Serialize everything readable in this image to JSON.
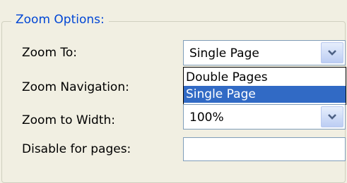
{
  "group": {
    "title": "Zoom Options:"
  },
  "rows": {
    "zoom_to": {
      "label": "Zoom To:",
      "value": "Single Page"
    },
    "zoom_navigation": {
      "label": "Zoom Navigation:"
    },
    "zoom_to_width": {
      "label": "Zoom to Width:",
      "value": "100%"
    },
    "disable_for_pages": {
      "label": "Disable for pages:",
      "value": ""
    }
  },
  "dropdown": {
    "options": [
      "Double Pages",
      "Single Page"
    ],
    "selected_index": 1
  },
  "colors": {
    "legend": "#0046d5",
    "selection": "#316ac5",
    "background": "#f1efe2",
    "field_border": "#7f9db9"
  },
  "icons": {
    "dropdown_arrow": "chevron-down-icon"
  }
}
